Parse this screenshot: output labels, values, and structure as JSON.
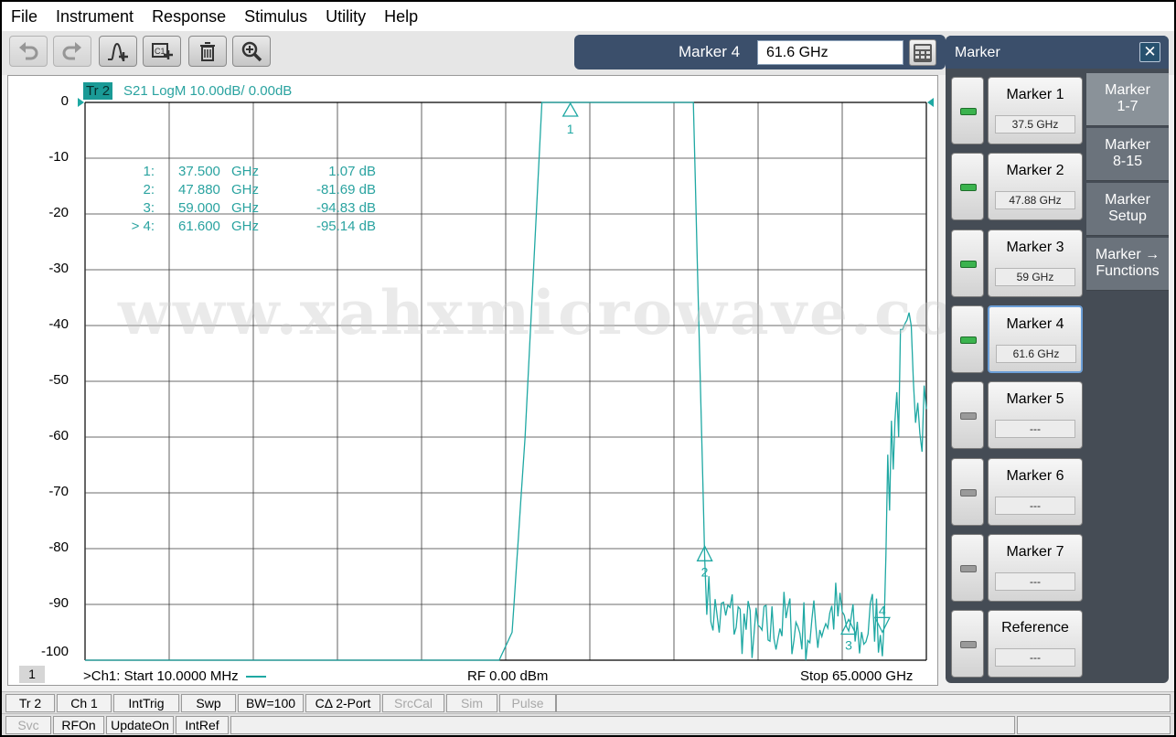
{
  "menu": [
    "File",
    "Instrument",
    "Response",
    "Stimulus",
    "Utility",
    "Help"
  ],
  "toolbar": {
    "buttons": [
      "undo-icon",
      "redo-icon",
      "add-trace-icon",
      "add-channel-icon",
      "delete-icon",
      "zoom-icon"
    ],
    "marker_label": "Marker 4",
    "marker_value": "61.6 GHz"
  },
  "plot": {
    "trace_badge": "Tr 2",
    "trace_title": "S21 LogM 10.00dB/  0.00dB",
    "y_ticks": [
      "0",
      "-10",
      "-20",
      "-30",
      "-40",
      "-50",
      "-60",
      "-70",
      "-80",
      "-90",
      "-100"
    ],
    "markers": [
      {
        "prefix": "1:",
        "freq": "37.500",
        "unit": "GHz",
        "value": "1.07 dB"
      },
      {
        "prefix": "2:",
        "freq": "47.880",
        "unit": "GHz",
        "value": "-81.69 dB"
      },
      {
        "prefix": "3:",
        "freq": "59.000",
        "unit": "GHz",
        "value": "-94.83 dB"
      },
      {
        "prefix": "> 4:",
        "freq": "61.600",
        "unit": "GHz",
        "value": "-95.14 dB"
      }
    ],
    "marker_ids": [
      "1",
      "2",
      "3",
      "4"
    ],
    "watermark": "www.xahxmicrowave.com",
    "channel_number": "1",
    "start_text": ">Ch1:  Start   10.0000 MHz",
    "rf_text": "RF    0.00 dBm",
    "stop_text": "Stop  65.0000 GHz",
    "trace_color": "#1fa8a3"
  },
  "chart_data": {
    "type": "line",
    "xlabel": "",
    "ylabel": "",
    "xlim": [
      0.01,
      65
    ],
    "ylim": [
      -100,
      0
    ],
    "grid": true,
    "x": [
      0.01,
      0.3,
      1,
      5,
      10,
      20,
      30,
      32.0,
      33.0,
      34.0,
      35.3,
      36.0,
      40.0,
      45.0,
      47.0,
      47.88,
      48.2,
      49.0,
      50,
      52,
      54,
      56,
      58,
      59,
      60,
      61,
      61.6,
      62.3,
      63,
      64,
      65
    ],
    "values": [
      -100,
      -100,
      -100,
      -100,
      -100,
      -100,
      -100,
      -100,
      -95,
      -60,
      0,
      0,
      0,
      0,
      0,
      -81.69,
      -90,
      -93,
      -92,
      -96,
      -93,
      -95,
      -91,
      -94.83,
      -96,
      -92,
      -95.14,
      -60,
      -50,
      -45,
      -55
    ]
  },
  "panel": {
    "title": "Marker",
    "buttons": [
      {
        "label": "Marker 1",
        "value": "37.5 GHz",
        "on": true
      },
      {
        "label": "Marker 2",
        "value": "47.88 GHz",
        "on": true
      },
      {
        "label": "Marker 3",
        "value": "59 GHz",
        "on": true
      },
      {
        "label": "Marker 4",
        "value": "61.6 GHz",
        "on": true
      },
      {
        "label": "Marker 5",
        "value": "---",
        "on": false
      },
      {
        "label": "Marker 6",
        "value": "---",
        "on": false
      },
      {
        "label": "Marker 7",
        "value": "---",
        "on": false
      },
      {
        "label": "Reference",
        "value": "---",
        "on": false
      }
    ],
    "tabs": [
      {
        "line1": "Marker",
        "line2": "1-7"
      },
      {
        "line1": "Marker",
        "line2": "8-15"
      },
      {
        "line1": "Marker",
        "line2": "Setup"
      },
      {
        "line1": "Marker →",
        "line2": "Functions"
      }
    ]
  },
  "status1": [
    "Tr 2",
    "Ch 1",
    "IntTrig",
    "Swp",
    "BW=100",
    "CΔ 2-Port",
    "SrcCal",
    "Sim",
    "Pulse"
  ],
  "status2": [
    "Svc",
    "RFOn",
    "UpdateOn",
    "IntRef"
  ]
}
